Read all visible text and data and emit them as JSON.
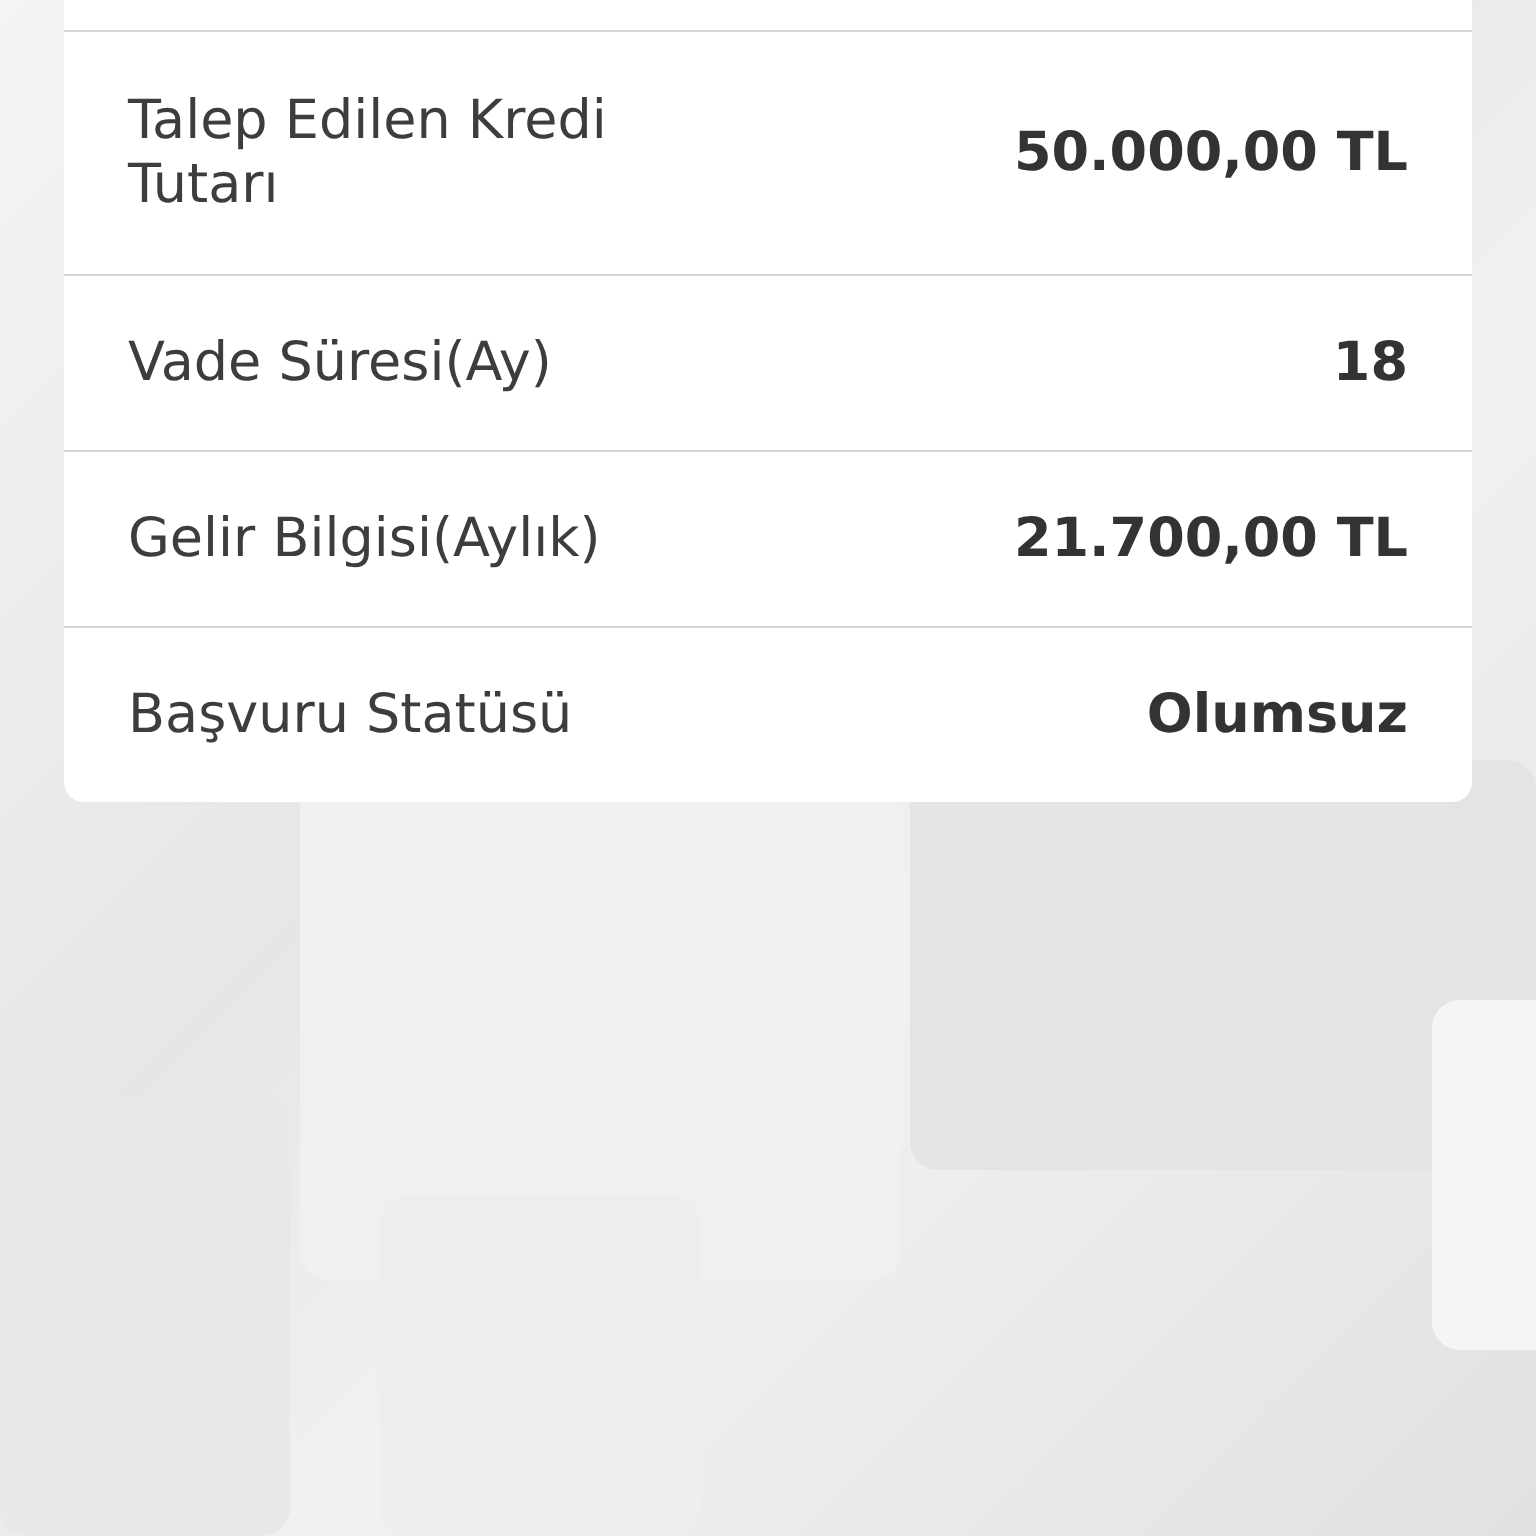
{
  "rows": [
    {
      "label": "Talep Edilen Kredi Tutarı",
      "value": "50.000,00 TL"
    },
    {
      "label": "Vade Süresi(Ay)",
      "value": "18"
    },
    {
      "label": "Gelir Bilgisi(Aylık)",
      "value": "21.700,00 TL"
    },
    {
      "label": "Başvuru Statüsü",
      "value": "Olumsuz"
    }
  ]
}
